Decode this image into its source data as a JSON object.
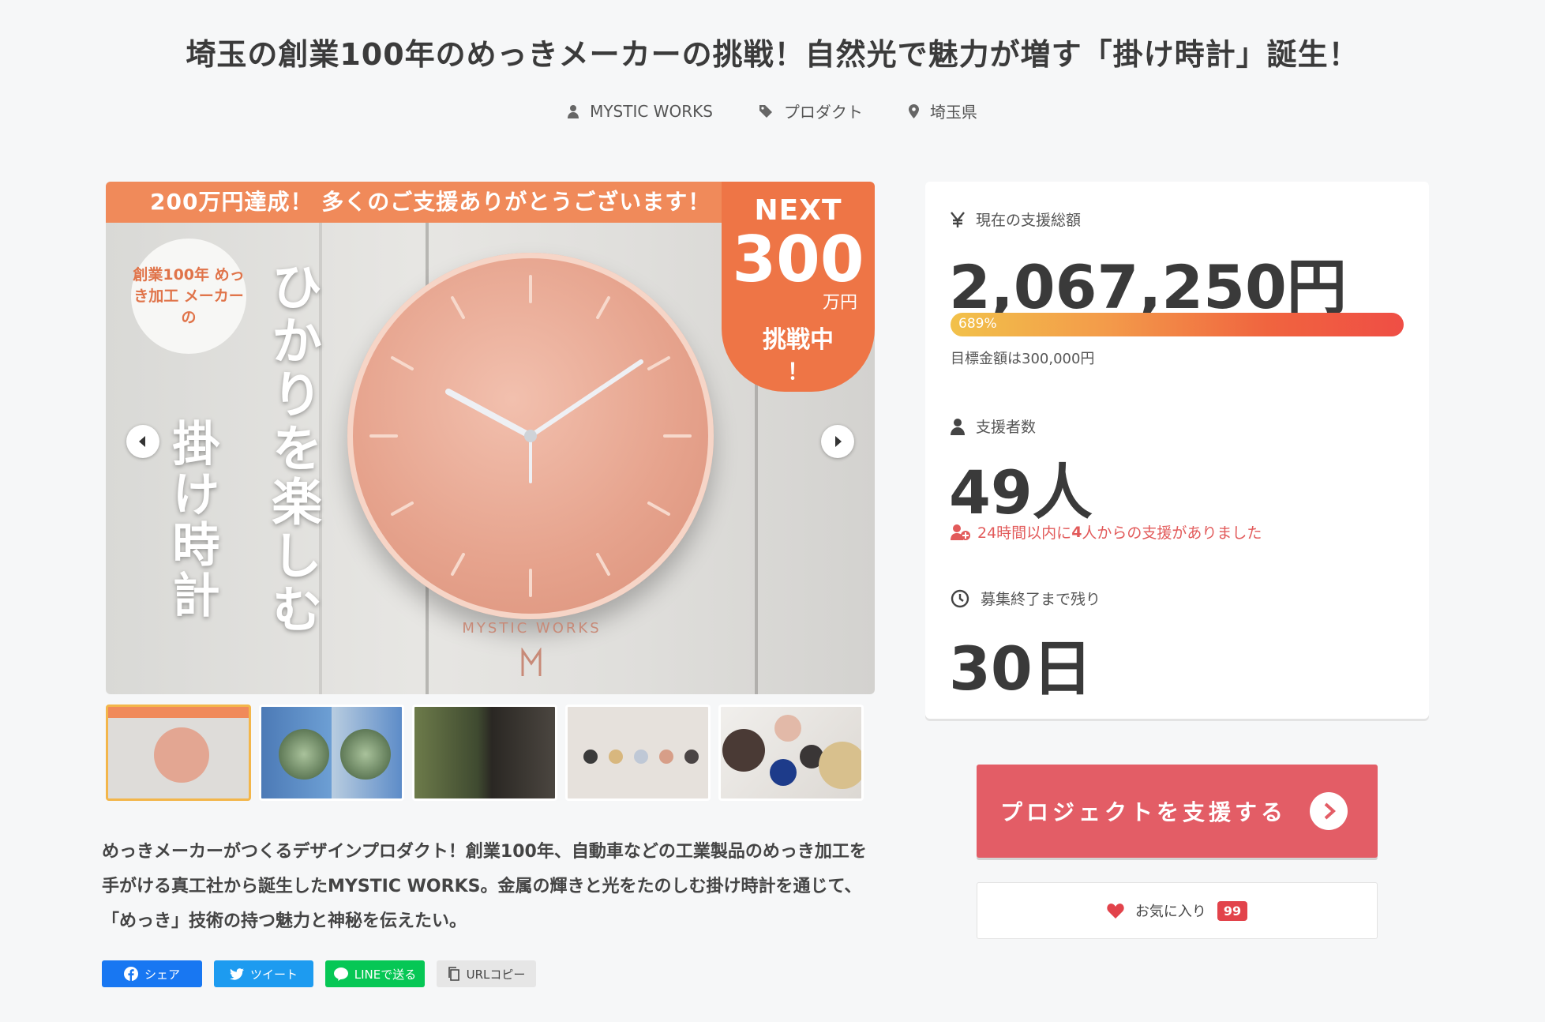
{
  "page": {
    "title": "埼玉の創業100年のめっきメーカーの挑戦！自然光で魅力が増す「掛け時計」誕生！",
    "meta": {
      "owner": "MYSTIC WORKS",
      "category": "プロダクト",
      "location": "埼玉県"
    }
  },
  "hero": {
    "banner_top": "200万円達成！ 多くのご支援ありがとうございます！",
    "next_label": "NEXT",
    "next_amount": "300",
    "next_unit": "万円",
    "next_challenge": "挑戦中",
    "next_exclaim": "！",
    "circle_badge": "創業100年 めっき加工 メーカー の",
    "vertical_main": "ひかりを楽しむ",
    "vertical_sub": "掛け時計",
    "clock_brand": "MYSTIC WORKS"
  },
  "description": "めっきメーカーがつくるデザインプロダクト！創業100年、自動車などの工業製品のめっき加工を手がける真工社から誕生したMYSTIC WORKS。金属の輝きと光をたのしむ掛け時計を通じて、「めっき」技術の持つ魅力と神秘を伝えたい。",
  "share": {
    "facebook": "シェア",
    "twitter": "ツイート",
    "line": "LINEで送る",
    "url": "URLコピー"
  },
  "stats": {
    "funding_label": "現在の支援総額",
    "funding_amount": "2,067,250円",
    "progress_percent_label": "689%",
    "progress_percent": 689,
    "target": "目標金額は300,000円",
    "backers_label": "支援者数",
    "backers_count": "49人",
    "recent_prefix": "24時間以内に",
    "recent_count": "4",
    "recent_suffix": "人からの支援がありました",
    "remaining_label": "募集終了まで残り",
    "remaining_days": "30日"
  },
  "actions": {
    "support_button": "プロジェクトを支援する",
    "favorite_label": "お気に入り",
    "favorite_count": "99"
  },
  "colors": {
    "accent": "#e35d66",
    "banner": "#f08a5a",
    "progress_start": "#f2c14a",
    "progress_end": "#ef4e45"
  }
}
